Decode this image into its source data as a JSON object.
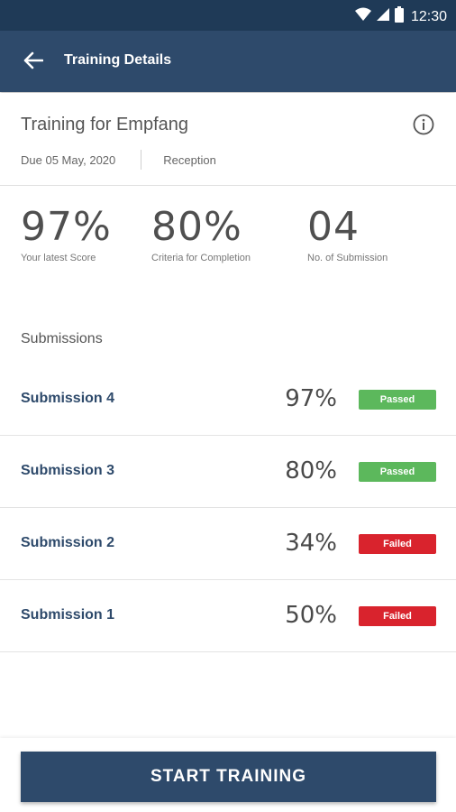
{
  "status_bar": {
    "time": "12:30",
    "icons": [
      "wifi-icon",
      "signal-icon",
      "battery-icon"
    ]
  },
  "app_bar": {
    "title": "Training Details",
    "back_icon": "arrow-left-icon"
  },
  "training": {
    "title": "Training for Empfang",
    "due": "Due 05 May, 2020",
    "department": "Reception",
    "info_icon": "info-icon"
  },
  "stats": [
    {
      "value": "97%",
      "label": "Your latest Score"
    },
    {
      "value": "80%",
      "label": "Criteria for Completion"
    },
    {
      "value": "04",
      "label": "No. of Submission"
    }
  ],
  "submissions": {
    "title": "Submissions",
    "items": [
      {
        "name": "Submission 4",
        "score": "97%",
        "status": "Passed",
        "status_color": "#5cb85c"
      },
      {
        "name": "Submission 3",
        "score": "80%",
        "status": "Passed",
        "status_color": "#5cb85c"
      },
      {
        "name": "Submission 2",
        "score": "34%",
        "status": "Failed",
        "status_color": "#d9232d"
      },
      {
        "name": "Submission 1",
        "score": "50%",
        "status": "Failed",
        "status_color": "#d9232d"
      }
    ]
  },
  "actions": {
    "start_label": "START TRAINING"
  },
  "colors": {
    "primary": "#2e4a6b",
    "status_bar": "#1f3a57",
    "passed": "#5cb85c",
    "failed": "#d9232d"
  }
}
